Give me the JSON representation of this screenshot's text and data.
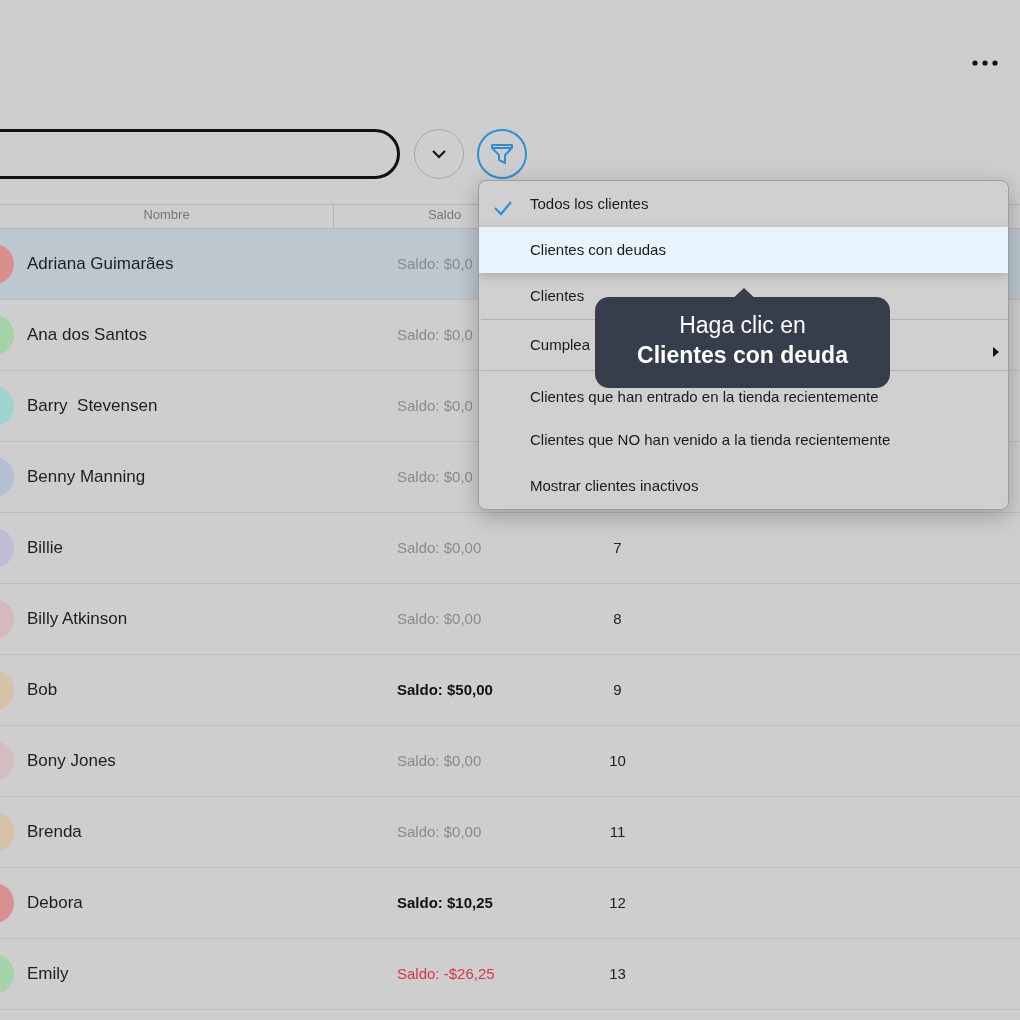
{
  "table": {
    "columns": [
      "Nombre",
      "Saldo"
    ],
    "rows": [
      {
        "name": "Adriana Guimarães",
        "balance": {
          "text": "Saldo: $0,0",
          "kind": "zero"
        },
        "number": "",
        "color": "#d98e8e",
        "selected": true
      },
      {
        "name": "Ana dos Santos",
        "balance": {
          "text": "Saldo: $0,0",
          "kind": "zero"
        },
        "number": "",
        "color": "#a3d3a6",
        "selected": false
      },
      {
        "name": "Barry  Stevensen",
        "balance": {
          "text": "Saldo: $0,0",
          "kind": "zero"
        },
        "number": "",
        "color": "#9fd3cf",
        "selected": false
      },
      {
        "name": "Benny Manning",
        "balance": {
          "text": "Saldo: $0,0",
          "kind": "zero"
        },
        "number": "",
        "color": "#b3bfd3",
        "selected": false
      },
      {
        "name": "Billie",
        "balance": {
          "text": "Saldo: $0,00",
          "kind": "zero"
        },
        "number": "7",
        "color": "#c2bcd6",
        "selected": false
      },
      {
        "name": "Billy Atkinson",
        "balance": {
          "text": "Saldo: $0,00",
          "kind": "zero"
        },
        "number": "8",
        "color": "#d6b9bd",
        "selected": false
      },
      {
        "name": "Bob",
        "balance": {
          "text": "Saldo: $50,00",
          "kind": "credit"
        },
        "number": "9",
        "color": "#d6c2a6",
        "selected": false
      },
      {
        "name": "Bony Jones",
        "balance": {
          "text": "Saldo: $0,00",
          "kind": "zero"
        },
        "number": "10",
        "color": "#d5bcc0",
        "selected": false
      },
      {
        "name": "Brenda",
        "balance": {
          "text": "Saldo: $0,00",
          "kind": "zero"
        },
        "number": "11",
        "color": "#d6c2a7",
        "selected": false
      },
      {
        "name": "Debora",
        "balance": {
          "text": "Saldo: $10,25",
          "kind": "credit"
        },
        "number": "12",
        "color": "#d98e8f",
        "selected": false
      },
      {
        "name": "Emily",
        "balance": {
          "text": "Saldo: -$26,25",
          "kind": "debt"
        },
        "number": "13",
        "color": "#a3d3a7",
        "selected": false
      }
    ]
  },
  "filter_menu": {
    "items": [
      {
        "kind": "item",
        "label": "Todos los clientes",
        "selected": true,
        "hovered": false
      },
      {
        "kind": "item",
        "label": "Clientes con deudas",
        "selected": false,
        "hovered": true
      },
      {
        "kind": "item",
        "label": "Clientes",
        "selected": false,
        "hovered": false
      },
      {
        "kind": "divider"
      },
      {
        "kind": "submenu",
        "label": "Cumplea",
        "selected": false,
        "hovered": false
      },
      {
        "kind": "divider"
      },
      {
        "kind": "item",
        "label": "Clientes que han entrado en la tienda recientemente",
        "selected": false,
        "hovered": false
      },
      {
        "kind": "item",
        "label": "Clientes que NO han venido a la tienda recientemente",
        "selected": false,
        "hovered": false
      },
      {
        "kind": "item",
        "label": "Mostrar clientes inactivos",
        "selected": false,
        "hovered": false
      }
    ]
  },
  "tooltip": {
    "text": "Haga clic en **Clientes con deuda**"
  }
}
